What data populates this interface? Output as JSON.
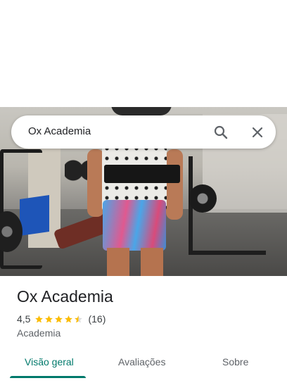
{
  "search": {
    "query": "Ox Academia"
  },
  "place": {
    "name": "Ox Academia",
    "rating": "4,5",
    "stars_filled": 4.5,
    "review_count": "(16)",
    "category": "Academia"
  },
  "tabs": [
    {
      "label": "Visão geral",
      "active": true
    },
    {
      "label": "Avaliações",
      "active": false
    },
    {
      "label": "Sobre",
      "active": false
    }
  ],
  "colors": {
    "accent": "#00796b",
    "star": "#fbbc04",
    "text": "#202124",
    "secondary_text": "#5f6368"
  },
  "icons": [
    "search-icon",
    "close-icon",
    "star-icon"
  ]
}
